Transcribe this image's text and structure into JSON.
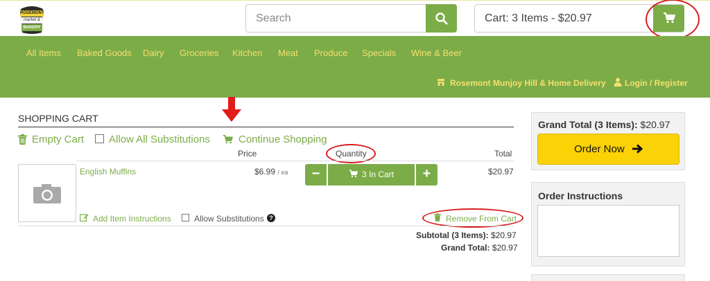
{
  "brand": {
    "logo_lines": [
      "ROSEMONT",
      "market &",
      "BAKERY"
    ]
  },
  "search": {
    "placeholder": "Search",
    "icon": "search-icon"
  },
  "cart": {
    "summary": "Cart: 3 Items - $20.97",
    "icon": "cart-icon"
  },
  "nav": {
    "items": [
      "All Items",
      "Baked Goods",
      "Dairy",
      "Groceries",
      "Kitchen",
      "Meat",
      "Produce",
      "Specials",
      "Wine & Beer"
    ],
    "store": "Rosemont Munjoy Hill & Home Delivery",
    "login": "Login / Register"
  },
  "shopping_cart": {
    "title": "SHOPPING CART",
    "empty_cart": "Empty Cart",
    "allow_all_subs": "Allow All Substitutions",
    "continue_shopping": "Continue Shopping",
    "columns": {
      "price": "Price",
      "quantity": "Quantity",
      "total": "Total"
    },
    "item": {
      "name": "English Muffins",
      "price": "$6.99",
      "unit": "/ ea",
      "qty_label": "3 In Cart",
      "total": "$20.97",
      "add_instructions": "Add Item Instructions",
      "allow_substitutions": "Allow Substitutions",
      "remove": "Remove From Cart"
    },
    "subtotal_label": "Subtotal (3 Items):",
    "subtotal_value": "$20.97",
    "grand_label": "Grand Total:",
    "grand_value": "$20.97"
  },
  "sidebar": {
    "grand_total_label": "Grand Total (3 Items):",
    "grand_total_value": "$20.97",
    "order_now": "Order Now",
    "order_instructions_title": "Order Instructions"
  },
  "colors": {
    "accent": "#7cac48",
    "nav_text": "#f4e06d",
    "order_button": "#fbd206",
    "annotation": "#d81c1c"
  }
}
